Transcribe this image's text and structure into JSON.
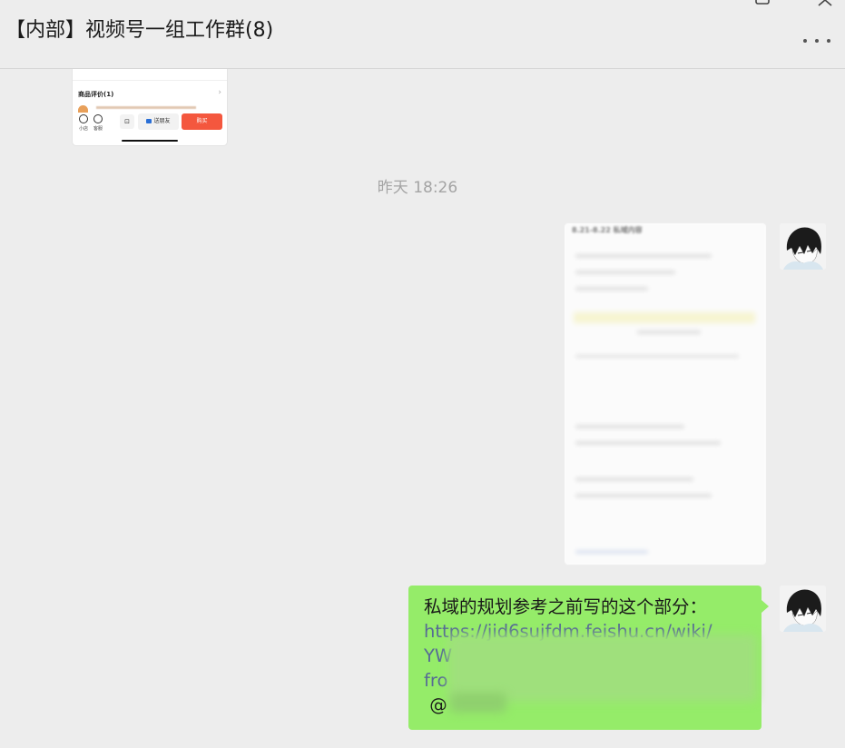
{
  "window": {
    "title": "【内部】视频号一组工作群(8)",
    "controls": [
      "maximize-icon",
      "close-icon"
    ],
    "more_icon": "more-horizontal-icon"
  },
  "prev_image": {
    "review_title": "商品评价(1)",
    "review_chevron": "›",
    "bottom_bar": {
      "shop_label": "小店",
      "service_label": "客服",
      "cart_icon": "cart-icon",
      "share_label": "送朋友",
      "buy_label": "购买"
    }
  },
  "timestamp": "昨天 18:26",
  "image_message": {
    "heading": "8.21-8.22 私域内容"
  },
  "text_message": {
    "line1": "私域的规划参考之前写的这个部分：",
    "line2_link": "https://jid6sujfdm.feishu.cn/wiki/",
    "line3_link": "YW",
    "line4_link": "fro",
    "line5": " @"
  },
  "colors": {
    "background": "#ededed",
    "bubble_green": "#95ec69",
    "link_blue": "#576b95",
    "timestamp_gray": "#a4a4a4",
    "buy_red": "#f4573e"
  }
}
